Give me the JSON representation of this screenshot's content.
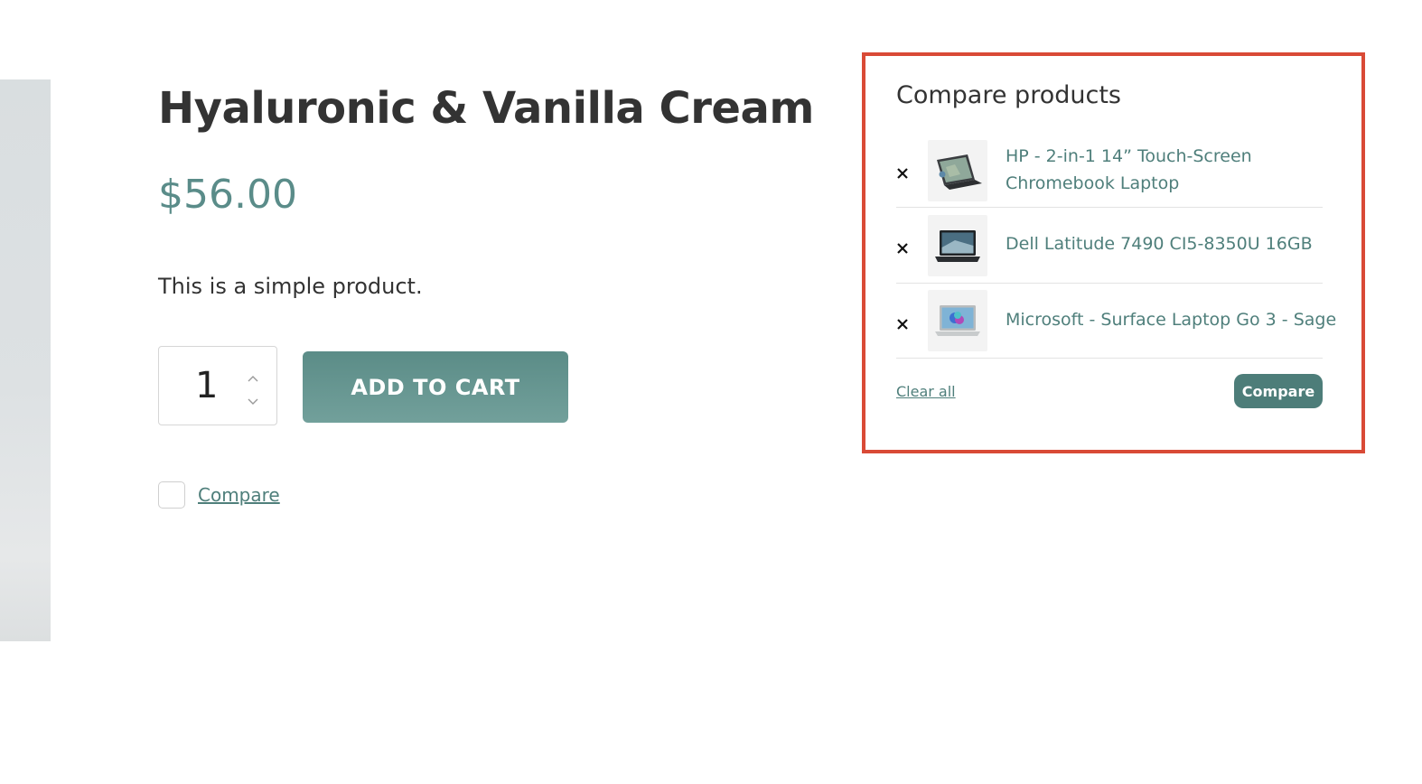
{
  "product": {
    "title": "Hyaluronic & Vanilla Cream",
    "price": "$56.00",
    "description": "This is a simple product.",
    "quantity": "1",
    "add_to_cart_label": "ADD TO CART",
    "compare_label": "Compare",
    "compare_checked": false
  },
  "compare_panel": {
    "title": "Compare products",
    "items": [
      {
        "name": "HP - 2-in-1 14” Touch-Screen Chromebook Laptop",
        "thumbnail_icon": "laptop-2in1-icon"
      },
      {
        "name": "Dell Latitude 7490 CI5-8350U 16GB",
        "thumbnail_icon": "laptop-icon"
      },
      {
        "name": "Microsoft - Surface Laptop Go 3 - Sage",
        "thumbnail_icon": "laptop-icon"
      }
    ],
    "clear_all_label": "Clear all",
    "compare_button_label": "Compare"
  },
  "colors": {
    "accent": "#5b8c87",
    "link": "#4f7f7b",
    "highlight_border": "#d94a36"
  }
}
